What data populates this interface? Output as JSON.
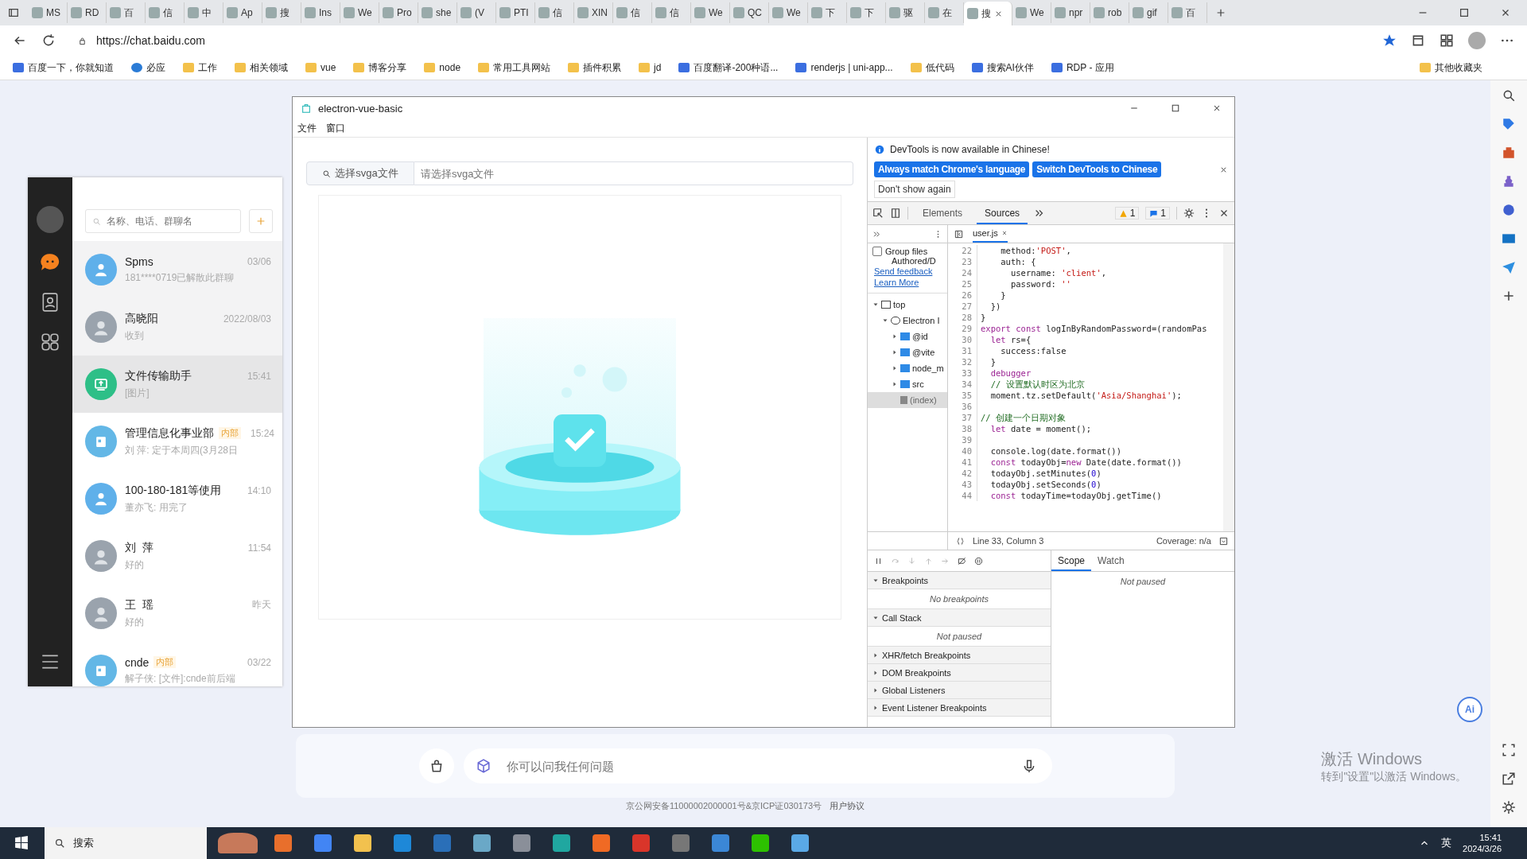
{
  "browser": {
    "tabs": [
      {
        "label": "MS",
        "selected": false
      },
      {
        "label": "RD",
        "selected": false
      },
      {
        "label": "百",
        "selected": false
      },
      {
        "label": "信",
        "selected": false
      },
      {
        "label": "中",
        "selected": false
      },
      {
        "label": "Ap",
        "selected": false
      },
      {
        "label": "搜",
        "selected": false
      },
      {
        "label": "Ins",
        "selected": false
      },
      {
        "label": "We",
        "selected": false
      },
      {
        "label": "Pro",
        "selected": false
      },
      {
        "label": "she",
        "selected": false
      },
      {
        "label": "(V",
        "selected": false
      },
      {
        "label": "PTI",
        "selected": false
      },
      {
        "label": "信",
        "selected": false
      },
      {
        "label": "XIN",
        "selected": false
      },
      {
        "label": "信",
        "selected": false
      },
      {
        "label": "信",
        "selected": false
      },
      {
        "label": "We",
        "selected": false
      },
      {
        "label": "QC",
        "selected": false
      },
      {
        "label": "We",
        "selected": false
      },
      {
        "label": "下",
        "selected": false
      },
      {
        "label": "下",
        "selected": false
      },
      {
        "label": "驱",
        "selected": false
      },
      {
        "label": "在",
        "selected": false
      },
      {
        "label": "搜",
        "selected": true
      },
      {
        "label": "We",
        "selected": false
      },
      {
        "label": "npr",
        "selected": false
      },
      {
        "label": "rob",
        "selected": false
      },
      {
        "label": "gif",
        "selected": false
      },
      {
        "label": "百",
        "selected": false
      }
    ],
    "url": "https://chat.baidu.com",
    "bookmarks": [
      {
        "label": "百度一下，你就知道",
        "kind": "site"
      },
      {
        "label": "必应",
        "kind": "search"
      },
      {
        "label": "工作",
        "kind": "folder"
      },
      {
        "label": "相关领域",
        "kind": "folder"
      },
      {
        "label": "vue",
        "kind": "folder"
      },
      {
        "label": "博客分享",
        "kind": "folder"
      },
      {
        "label": "node",
        "kind": "folder"
      },
      {
        "label": "常用工具网站",
        "kind": "folder"
      },
      {
        "label": "插件积累",
        "kind": "folder"
      },
      {
        "label": "jd",
        "kind": "folder"
      },
      {
        "label": "百度翻译-200种语...",
        "kind": "site"
      },
      {
        "label": "renderjs | uni-app...",
        "kind": "site"
      },
      {
        "label": "低代码",
        "kind": "folder"
      },
      {
        "label": "搜索AI伙伴",
        "kind": "site"
      },
      {
        "label": "RDP - 应用",
        "kind": "site"
      }
    ],
    "other_bookmarks": "其他收藏夹"
  },
  "chat_app": {
    "search": {
      "placeholder": "名称、电话、群聊名"
    },
    "conversations": [
      {
        "name": "Spms",
        "preview": "181****0719已解散此群聊",
        "time": "03/06",
        "kind": "group",
        "pinned": true,
        "selected": false
      },
      {
        "name": "高晓阳",
        "preview": "收到",
        "time": "2022/08/03",
        "kind": "photo",
        "pinned": true,
        "selected": false
      },
      {
        "name": "文件传输助手",
        "preview": "[图片]",
        "time": "15:41",
        "kind": "file",
        "pinned": false,
        "selected": true
      },
      {
        "name": "管理信息化事业部",
        "badge": "内部",
        "preview": "刘 萍: 定于本周四(3月28日",
        "time": "15:24",
        "kind": "org",
        "pinned": false,
        "selected": false
      },
      {
        "name": "100-180-181等使用",
        "preview": "董亦飞: 用完了",
        "time": "14:10",
        "kind": "group",
        "pinned": false,
        "selected": false
      },
      {
        "name": "刘  萍",
        "preview": "好的",
        "time": "11:54",
        "kind": "photo",
        "pinned": false,
        "selected": false
      },
      {
        "name": "王  瑶",
        "preview": "好的",
        "time": "昨天",
        "kind": "photo",
        "pinned": false,
        "selected": false
      },
      {
        "name": "cnde",
        "badge": "内部",
        "preview": "解子侠: [文件]:cnde前后端",
        "time": "03/22",
        "kind": "org",
        "pinned": false,
        "selected": false
      }
    ]
  },
  "ai_input": {
    "placeholder": "你可以问我任何问题"
  },
  "footer": {
    "text": "京公网安备11000002000001号&京ICP证030173号",
    "link": "用户协议"
  },
  "ai_button": "Ai",
  "activation": {
    "title": "激活 Windows",
    "hint": "转到\"设置\"以激活 Windows。"
  },
  "electron_window": {
    "title": "electron-vue-basic",
    "menu": [
      "文件",
      "窗口"
    ],
    "file_button": "选择svga文件",
    "file_placeholder": "请选择svga文件"
  },
  "devtools": {
    "notice": "DevTools is now available in Chinese!",
    "notice_buttons": [
      "Always match Chrome's language",
      "Switch DevTools to Chinese"
    ],
    "dont_show": "Don't show again",
    "tabs": [
      {
        "label": "Elements",
        "selected": false
      },
      {
        "label": "Sources",
        "selected": true
      }
    ],
    "warnings": "1",
    "messages": "1",
    "navigator": {
      "group_files": "Group files",
      "group_files_checked": false,
      "authored": "Authored/D",
      "send_feedback": "Send feedback",
      "learn_more": "Learn More",
      "tree": [
        {
          "label": "top",
          "kind": "frame",
          "expanded": true,
          "selected": false,
          "children": [
            {
              "label": "Electron I",
              "kind": "cloud",
              "expanded": true,
              "selected": false,
              "children": [
                {
                  "label": "@id",
                  "kind": "folder",
                  "expanded": false,
                  "selected": false
                },
                {
                  "label": "@vite",
                  "kind": "folder",
                  "expanded": false,
                  "selected": false
                },
                {
                  "label": "node_m",
                  "kind": "folder",
                  "expanded": false,
                  "selected": false
                },
                {
                  "label": "src",
                  "kind": "folder",
                  "expanded": false,
                  "selected": false
                },
                {
                  "label": "(index)",
                  "kind": "file",
                  "selected": true
                }
              ]
            }
          ]
        }
      ]
    },
    "editor_tab": "user.js",
    "code": [
      {
        "num": "22",
        "segments": [
          {
            "t": "    method:",
            "kind": "plain"
          },
          {
            "t": "'POST'",
            "kind": "str"
          },
          {
            "t": ",",
            "kind": "plain"
          }
        ]
      },
      {
        "num": "23",
        "segments": [
          {
            "t": "    auth: {",
            "kind": "plain"
          }
        ]
      },
      {
        "num": "24",
        "segments": [
          {
            "t": "      username: ",
            "kind": "plain"
          },
          {
            "t": "'client'",
            "kind": "str"
          },
          {
            "t": ",",
            "kind": "plain"
          }
        ]
      },
      {
        "num": "25",
        "segments": [
          {
            "t": "      password: ",
            "kind": "plain"
          },
          {
            "t": "''",
            "kind": "str"
          }
        ]
      },
      {
        "num": "26",
        "segments": [
          {
            "t": "    }",
            "kind": "plain"
          }
        ]
      },
      {
        "num": "27",
        "segments": [
          {
            "t": "  })",
            "kind": "plain"
          }
        ]
      },
      {
        "num": "28",
        "segments": [
          {
            "t": "}",
            "kind": "plain"
          }
        ]
      },
      {
        "num": "29",
        "segments": [
          {
            "t": "export const ",
            "kind": "kw"
          },
          {
            "t": "logInByRandomPassword=(randomPas",
            "kind": "plain"
          }
        ]
      },
      {
        "num": "30",
        "segments": [
          {
            "t": "  let ",
            "kind": "kw"
          },
          {
            "t": "rs={",
            "kind": "plain"
          }
        ]
      },
      {
        "num": "31",
        "segments": [
          {
            "t": "    success:false",
            "kind": "plain"
          }
        ]
      },
      {
        "num": "32",
        "segments": [
          {
            "t": "  }",
            "kind": "plain"
          }
        ]
      },
      {
        "num": "33",
        "segments": [
          {
            "t": "  debugger",
            "kind": "kw"
          }
        ]
      },
      {
        "num": "34",
        "segments": [
          {
            "t": "  // 设置默认时区为北京",
            "kind": "cmt"
          }
        ]
      },
      {
        "num": "35",
        "segments": [
          {
            "t": "  moment.tz.setDefault(",
            "kind": "plain"
          },
          {
            "t": "'Asia/Shanghai'",
            "kind": "str"
          },
          {
            "t": ");",
            "kind": "plain"
          }
        ]
      },
      {
        "num": "36"
      },
      {
        "num": "37",
        "segments": [
          {
            "t": "// 创建一个日期对象",
            "kind": "cmt"
          }
        ]
      },
      {
        "num": "38",
        "segments": [
          {
            "t": "  let ",
            "kind": "kw"
          },
          {
            "t": "date = moment();",
            "kind": "plain"
          }
        ]
      },
      {
        "num": "39"
      },
      {
        "num": "40",
        "segments": [
          {
            "t": "  console.log(date.format())",
            "kind": "plain"
          }
        ]
      },
      {
        "num": "41",
        "segments": [
          {
            "t": "  const ",
            "kind": "kw"
          },
          {
            "t": "todayObj=",
            "kind": "plain"
          },
          {
            "t": "new ",
            "kind": "kw"
          },
          {
            "t": "Date(date.format())",
            "kind": "plain"
          }
        ]
      },
      {
        "num": "42",
        "segments": [
          {
            "t": "  todayObj.setMinutes(",
            "kind": "plain"
          },
          {
            "t": "0",
            "kind": "num"
          },
          {
            "t": ")",
            "kind": "plain"
          }
        ]
      },
      {
        "num": "43",
        "segments": [
          {
            "t": "  todayObj.setSeconds(",
            "kind": "plain"
          },
          {
            "t": "0",
            "kind": "num"
          },
          {
            "t": ")",
            "kind": "plain"
          }
        ]
      },
      {
        "num": "44",
        "segments": [
          {
            "t": "  const ",
            "kind": "kw"
          },
          {
            "t": "todayTime=todayObj.getTime()",
            "kind": "plain"
          }
        ]
      }
    ],
    "cursor": "Line 33, Column 3",
    "coverage": "Coverage: n/a",
    "sections": [
      {
        "title": "Breakpoints",
        "expanded": true,
        "message": "No breakpoints"
      },
      {
        "title": "Call Stack",
        "expanded": true,
        "message": "Not paused"
      },
      {
        "title": "XHR/fetch Breakpoints",
        "expanded": false
      },
      {
        "title": "DOM Breakpoints",
        "expanded": false
      },
      {
        "title": "Global Listeners",
        "expanded": false
      },
      {
        "title": "Event Listener Breakpoints",
        "expanded": false
      }
    ],
    "side_tabs": [
      {
        "label": "Scope",
        "selected": true
      },
      {
        "label": "Watch",
        "selected": false
      }
    ],
    "scope_message": "Not paused"
  },
  "taskbar": {
    "search": "搜索",
    "ime": "英",
    "time": "15:41",
    "date": "2024/3/26"
  }
}
